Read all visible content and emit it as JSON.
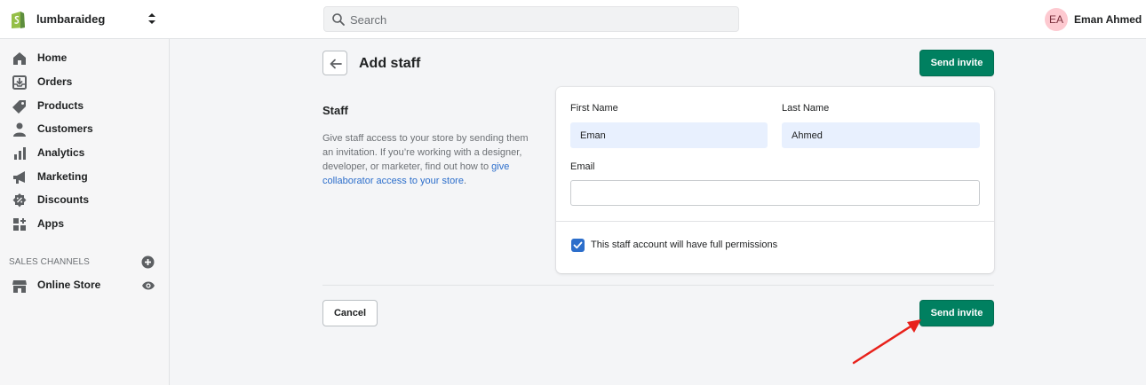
{
  "topbar": {
    "store_name": "lumbaraideg",
    "search_placeholder": "Search",
    "user_initials": "EA",
    "user_name": "Eman Ahmed"
  },
  "sidebar": {
    "items": [
      {
        "label": "Home",
        "icon": "home-icon"
      },
      {
        "label": "Orders",
        "icon": "orders-icon"
      },
      {
        "label": "Products",
        "icon": "tag-icon"
      },
      {
        "label": "Customers",
        "icon": "person-icon"
      },
      {
        "label": "Analytics",
        "icon": "bar-chart-icon"
      },
      {
        "label": "Marketing",
        "icon": "megaphone-icon"
      },
      {
        "label": "Discounts",
        "icon": "discount-icon"
      },
      {
        "label": "Apps",
        "icon": "apps-icon"
      }
    ],
    "sales_channels_label": "SALES CHANNELS",
    "channels": [
      {
        "label": "Online Store",
        "icon": "store-icon"
      }
    ]
  },
  "page": {
    "title": "Add staff",
    "send_invite_label": "Send invite",
    "cancel_label": "Cancel"
  },
  "staff_section": {
    "heading": "Staff",
    "description_prefix": "Give staff access to your store by sending them an invitation. If you’re working with a designer, developer, or marketer, find out how to ",
    "description_link": "give collaborator access to your store",
    "description_suffix": "."
  },
  "form": {
    "first_name_label": "First Name",
    "first_name_value": "Eman",
    "last_name_label": "Last Name",
    "last_name_value": "Ahmed",
    "email_label": "Email",
    "email_value": "",
    "full_permissions_label": "This staff account will have full permissions",
    "full_permissions_checked": true
  },
  "colors": {
    "primary": "#008060",
    "link": "#2c6ecb",
    "annotation_arrow": "#e8211b"
  }
}
